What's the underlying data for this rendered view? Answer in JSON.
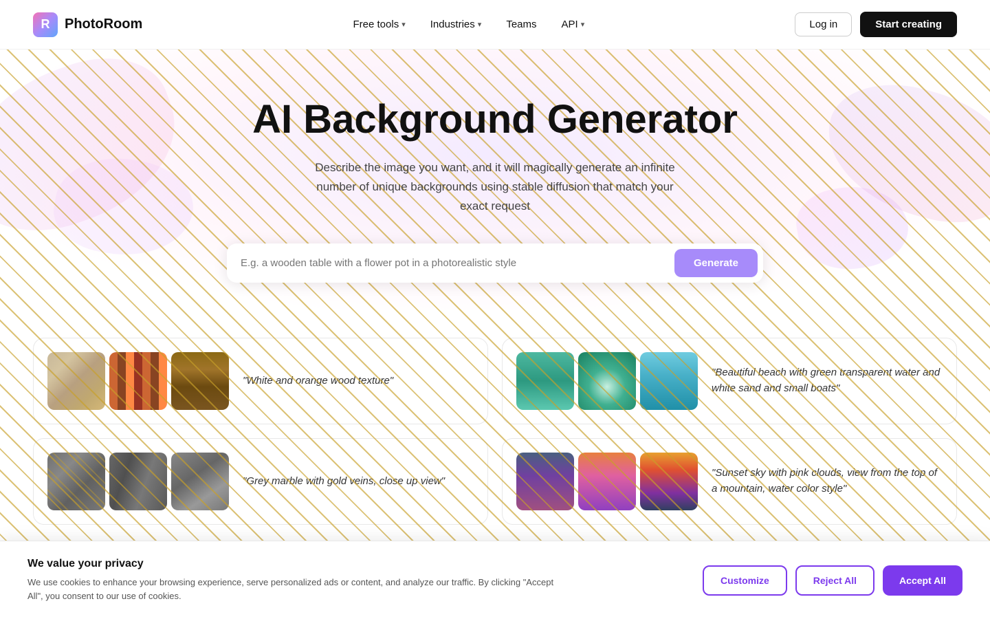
{
  "nav": {
    "logo_text": "PhotoRoom",
    "links": [
      {
        "label": "Free tools",
        "has_chevron": true
      },
      {
        "label": "Industries",
        "has_chevron": true
      },
      {
        "label": "Teams",
        "has_chevron": false
      },
      {
        "label": "API",
        "has_chevron": true
      }
    ],
    "login_label": "Log in",
    "start_label": "Start creating"
  },
  "hero": {
    "title": "AI Background Generator",
    "description": "Describe the image you want, and it will magically generate an infinite number of unique backgrounds using stable diffusion that match your exact request",
    "search_placeholder": "E.g. a wooden table with a flower pot in a photorealistic style",
    "generate_label": "Generate"
  },
  "gallery": {
    "cards": [
      {
        "id": "wood",
        "label": "\"White and orange wood texture\"",
        "images": [
          "img-wood1",
          "img-wood2",
          "img-wood3"
        ]
      },
      {
        "id": "beach",
        "label": "\"Beautiful beach with green transparent water and white sand and small boats\"",
        "images": [
          "img-beach1",
          "img-beach2",
          "img-beach3"
        ]
      },
      {
        "id": "marble",
        "label": "\"Grey marble with gold veins, close up view\"",
        "images": [
          "img-marble1",
          "img-marble2",
          "img-marble3"
        ]
      },
      {
        "id": "sunset",
        "label": "\"Sunset sky with pink clouds, view from the top of a mountain, water color style\"",
        "images": [
          "img-sunset1",
          "img-sunset2",
          "img-sunset3"
        ]
      }
    ]
  },
  "cookie": {
    "title": "We value your privacy",
    "description": "We use cookies to enhance your browsing experience, serve personalized ads or content, and analyze our traffic. By clicking \"Accept All\", you consent to our use of cookies.",
    "customize_label": "Customize",
    "reject_label": "Reject All",
    "accept_label": "Accept All"
  }
}
